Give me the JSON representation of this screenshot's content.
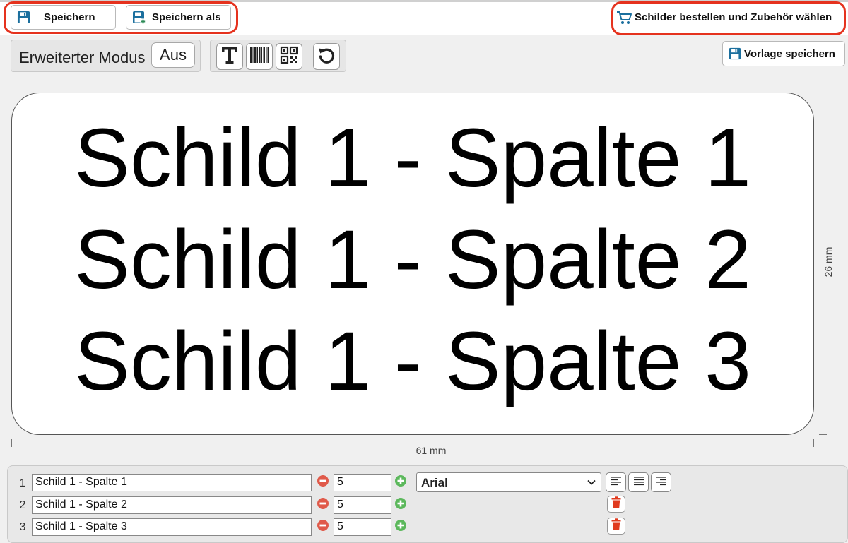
{
  "colors": {
    "accent": "#1b6f9e",
    "highlight_ring": "#e5321e",
    "delete": "#e03a1e",
    "plus": "#5cb85c",
    "minus": "#e05a4a"
  },
  "toolbar": {
    "save_label": "Speichern",
    "save_as_label": "Speichern als",
    "order_label": "Schilder bestellen und Zubehör wählen",
    "save_template_label": "Vorlage speichern"
  },
  "mode": {
    "label": "Erweiterter Modus",
    "toggle_value": "Aus"
  },
  "tools": {
    "icons": [
      "text-tool-icon",
      "barcode-icon",
      "qr-code-icon",
      "undo-icon"
    ]
  },
  "sign": {
    "lines": [
      "Schild 1 - Spalte 1",
      "Schild 1 - Spalte 2",
      "Schild 1 - Spalte 3"
    ],
    "width_label": "61 mm",
    "height_label": "26 mm"
  },
  "rows": [
    {
      "num": "1",
      "text": "Schild 1 - Spalte 1",
      "size": "5"
    },
    {
      "num": "2",
      "text": "Schild 1 - Spalte 2",
      "size": "5"
    },
    {
      "num": "3",
      "text": "Schild 1 - Spalte 3",
      "size": "5"
    }
  ],
  "font_select": {
    "value": "Arial"
  }
}
